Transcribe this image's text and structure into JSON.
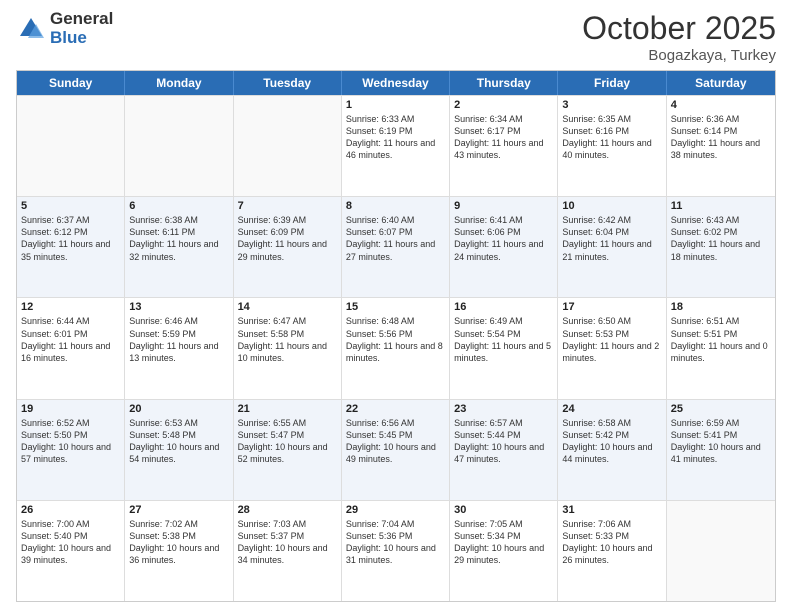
{
  "logo": {
    "general": "General",
    "blue": "Blue"
  },
  "title": {
    "month": "October 2025",
    "location": "Bogazkaya, Turkey"
  },
  "days": [
    "Sunday",
    "Monday",
    "Tuesday",
    "Wednesday",
    "Thursday",
    "Friday",
    "Saturday"
  ],
  "weeks": [
    [
      {
        "date": "",
        "info": ""
      },
      {
        "date": "",
        "info": ""
      },
      {
        "date": "",
        "info": ""
      },
      {
        "date": "1",
        "info": "Sunrise: 6:33 AM\nSunset: 6:19 PM\nDaylight: 11 hours and 46 minutes."
      },
      {
        "date": "2",
        "info": "Sunrise: 6:34 AM\nSunset: 6:17 PM\nDaylight: 11 hours and 43 minutes."
      },
      {
        "date": "3",
        "info": "Sunrise: 6:35 AM\nSunset: 6:16 PM\nDaylight: 11 hours and 40 minutes."
      },
      {
        "date": "4",
        "info": "Sunrise: 6:36 AM\nSunset: 6:14 PM\nDaylight: 11 hours and 38 minutes."
      }
    ],
    [
      {
        "date": "5",
        "info": "Sunrise: 6:37 AM\nSunset: 6:12 PM\nDaylight: 11 hours and 35 minutes."
      },
      {
        "date": "6",
        "info": "Sunrise: 6:38 AM\nSunset: 6:11 PM\nDaylight: 11 hours and 32 minutes."
      },
      {
        "date": "7",
        "info": "Sunrise: 6:39 AM\nSunset: 6:09 PM\nDaylight: 11 hours and 29 minutes."
      },
      {
        "date": "8",
        "info": "Sunrise: 6:40 AM\nSunset: 6:07 PM\nDaylight: 11 hours and 27 minutes."
      },
      {
        "date": "9",
        "info": "Sunrise: 6:41 AM\nSunset: 6:06 PM\nDaylight: 11 hours and 24 minutes."
      },
      {
        "date": "10",
        "info": "Sunrise: 6:42 AM\nSunset: 6:04 PM\nDaylight: 11 hours and 21 minutes."
      },
      {
        "date": "11",
        "info": "Sunrise: 6:43 AM\nSunset: 6:02 PM\nDaylight: 11 hours and 18 minutes."
      }
    ],
    [
      {
        "date": "12",
        "info": "Sunrise: 6:44 AM\nSunset: 6:01 PM\nDaylight: 11 hours and 16 minutes."
      },
      {
        "date": "13",
        "info": "Sunrise: 6:46 AM\nSunset: 5:59 PM\nDaylight: 11 hours and 13 minutes."
      },
      {
        "date": "14",
        "info": "Sunrise: 6:47 AM\nSunset: 5:58 PM\nDaylight: 11 hours and 10 minutes."
      },
      {
        "date": "15",
        "info": "Sunrise: 6:48 AM\nSunset: 5:56 PM\nDaylight: 11 hours and 8 minutes."
      },
      {
        "date": "16",
        "info": "Sunrise: 6:49 AM\nSunset: 5:54 PM\nDaylight: 11 hours and 5 minutes."
      },
      {
        "date": "17",
        "info": "Sunrise: 6:50 AM\nSunset: 5:53 PM\nDaylight: 11 hours and 2 minutes."
      },
      {
        "date": "18",
        "info": "Sunrise: 6:51 AM\nSunset: 5:51 PM\nDaylight: 11 hours and 0 minutes."
      }
    ],
    [
      {
        "date": "19",
        "info": "Sunrise: 6:52 AM\nSunset: 5:50 PM\nDaylight: 10 hours and 57 minutes."
      },
      {
        "date": "20",
        "info": "Sunrise: 6:53 AM\nSunset: 5:48 PM\nDaylight: 10 hours and 54 minutes."
      },
      {
        "date": "21",
        "info": "Sunrise: 6:55 AM\nSunset: 5:47 PM\nDaylight: 10 hours and 52 minutes."
      },
      {
        "date": "22",
        "info": "Sunrise: 6:56 AM\nSunset: 5:45 PM\nDaylight: 10 hours and 49 minutes."
      },
      {
        "date": "23",
        "info": "Sunrise: 6:57 AM\nSunset: 5:44 PM\nDaylight: 10 hours and 47 minutes."
      },
      {
        "date": "24",
        "info": "Sunrise: 6:58 AM\nSunset: 5:42 PM\nDaylight: 10 hours and 44 minutes."
      },
      {
        "date": "25",
        "info": "Sunrise: 6:59 AM\nSunset: 5:41 PM\nDaylight: 10 hours and 41 minutes."
      }
    ],
    [
      {
        "date": "26",
        "info": "Sunrise: 7:00 AM\nSunset: 5:40 PM\nDaylight: 10 hours and 39 minutes."
      },
      {
        "date": "27",
        "info": "Sunrise: 7:02 AM\nSunset: 5:38 PM\nDaylight: 10 hours and 36 minutes."
      },
      {
        "date": "28",
        "info": "Sunrise: 7:03 AM\nSunset: 5:37 PM\nDaylight: 10 hours and 34 minutes."
      },
      {
        "date": "29",
        "info": "Sunrise: 7:04 AM\nSunset: 5:36 PM\nDaylight: 10 hours and 31 minutes."
      },
      {
        "date": "30",
        "info": "Sunrise: 7:05 AM\nSunset: 5:34 PM\nDaylight: 10 hours and 29 minutes."
      },
      {
        "date": "31",
        "info": "Sunrise: 7:06 AM\nSunset: 5:33 PM\nDaylight: 10 hours and 26 minutes."
      },
      {
        "date": "",
        "info": ""
      }
    ]
  ]
}
